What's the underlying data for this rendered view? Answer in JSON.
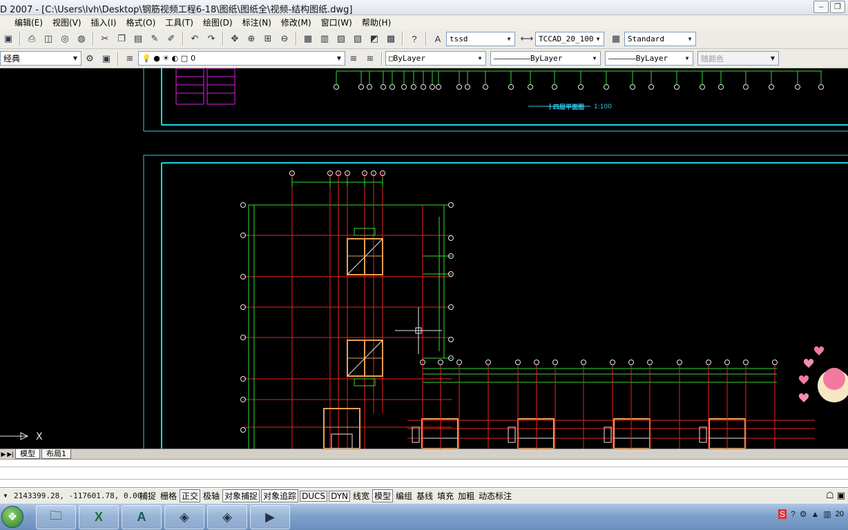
{
  "window": {
    "title": "D 2007 - [C:\\Users\\lvh\\Desktop\\钢筋视频工程6-18\\图纸\\图纸全\\视频-结构图纸.dwg]"
  },
  "menu": [
    "编辑(E)",
    "视图(V)",
    "插入(I)",
    "格式(O)",
    "工具(T)",
    "绘图(D)",
    "标注(N)",
    "修改(M)",
    "窗口(W)",
    "帮助(H)"
  ],
  "toolbar1": {
    "text_style": "tssd",
    "dim_style": "TCCAD_20_100",
    "table_style": "Standard"
  },
  "toolbar2": {
    "workspace": "经典",
    "layer": "0",
    "color": "ByLayer",
    "linetype": "ByLayer",
    "lineweight": "ByLayer",
    "plot_style": "随颜色"
  },
  "drawing": {
    "scale_label": "1:100",
    "title_text": "十四层平面图"
  },
  "layout_tabs": [
    "模型",
    "布局1"
  ],
  "status": {
    "coords": "2143399.28, -117601.78, 0.00",
    "buttons": [
      "捕捉",
      "栅格",
      "正交",
      "极轴",
      "对象捕捉",
      "对象追踪",
      "DUCS",
      "DYN",
      "线宽",
      "模型",
      "编组",
      "基线",
      "填充",
      "加粗",
      "动态标注"
    ],
    "active": [
      "正交",
      "对象捕捉",
      "对象追踪",
      "DUCS",
      "DYN",
      "模型"
    ]
  },
  "taskbar": {
    "clock": "20"
  },
  "colors": {
    "canvas": "#000000",
    "cyan": "#22d3e6",
    "green": "#33dd33",
    "red": "#ee2222",
    "orange": "#f0a050",
    "white": "#e8e8e8",
    "magenta": "#e020e0"
  }
}
